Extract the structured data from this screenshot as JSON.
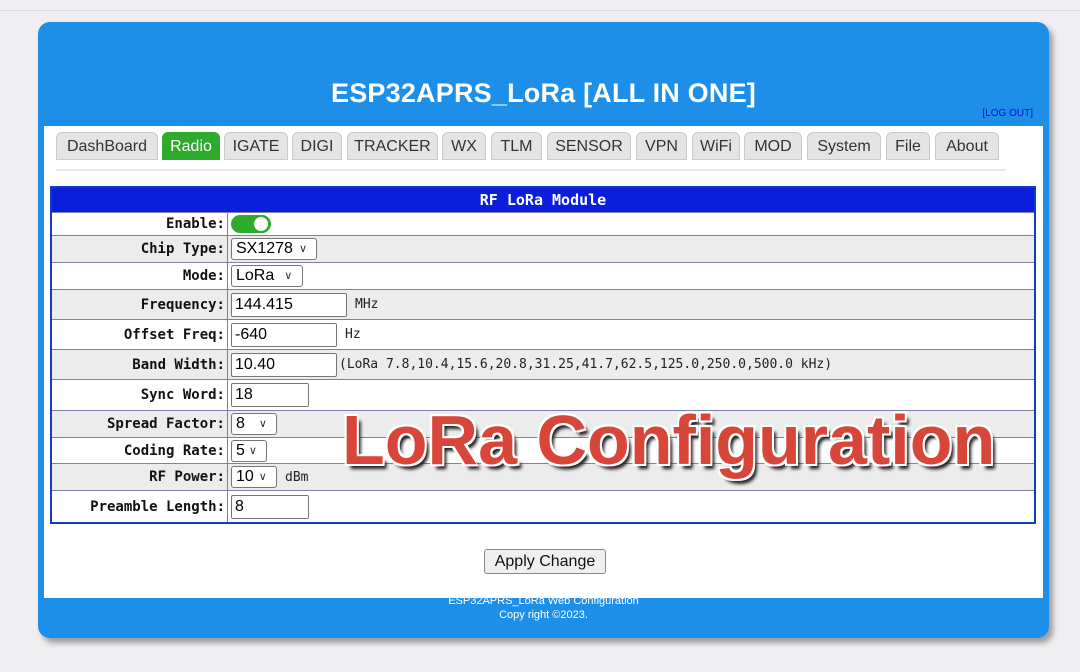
{
  "header": {
    "title": "ESP32APRS_LoRa [ALL IN ONE]",
    "logout": "[LOG OUT]"
  },
  "tabs": [
    {
      "label": "DashBoard"
    },
    {
      "label": "Radio",
      "active": true
    },
    {
      "label": "IGATE"
    },
    {
      "label": "DIGI"
    },
    {
      "label": "TRACKER"
    },
    {
      "label": "WX"
    },
    {
      "label": "TLM"
    },
    {
      "label": "SENSOR"
    },
    {
      "label": "VPN"
    },
    {
      "label": "WiFi"
    },
    {
      "label": "MOD"
    },
    {
      "label": "System"
    },
    {
      "label": "File"
    },
    {
      "label": "About"
    }
  ],
  "panel": {
    "title": "RF LoRa Module",
    "enable": {
      "label": "Enable:",
      "on": true
    },
    "chip_type": {
      "label": "Chip Type:",
      "value": "SX1278"
    },
    "mode": {
      "label": "Mode:",
      "value": "LoRa"
    },
    "frequency": {
      "label": "Frequency:",
      "value": "144.415",
      "unit": "MHz"
    },
    "offset_freq": {
      "label": "Offset Freq:",
      "value": "-640",
      "unit": "Hz"
    },
    "band_width": {
      "label": "Band Width:",
      "value": "10.40",
      "hint": "(LoRa 7.8,10.4,15.6,20.8,31.25,41.7,62.5,125.0,250.0,500.0 kHz)"
    },
    "sync_word": {
      "label": "Sync Word:",
      "value": "18"
    },
    "spread_factor": {
      "label": "Spread Factor:",
      "value": "8"
    },
    "coding_rate": {
      "label": "Coding Rate:",
      "value": "5"
    },
    "rf_power": {
      "label": "RF Power:",
      "value": "10",
      "unit": "dBm"
    },
    "preamble_length": {
      "label": "Preamble Length:",
      "value": "8"
    }
  },
  "apply_label": "Apply Change",
  "footer": {
    "line1": "ESP32APRS_LoRa Web Configuration",
    "line2": "Copy right ©2023."
  },
  "overlay_text": "LoRa Configuration",
  "colors": {
    "header_blue": "#1e8fe8",
    "active_tab": "#2eab2a",
    "panel_title": "#0a1edb",
    "overlay": "#d8463a"
  }
}
